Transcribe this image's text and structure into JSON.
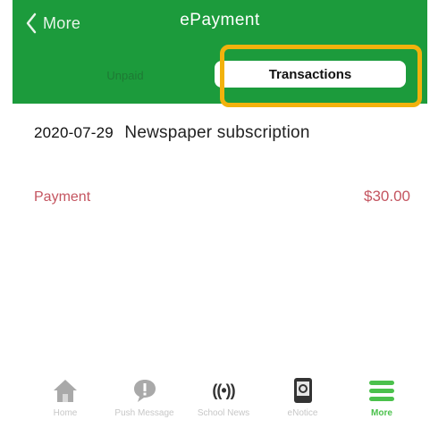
{
  "header": {
    "back_label": "More",
    "title": "ePayment"
  },
  "tabs": {
    "unpaid": "Unpaid",
    "transactions": "Transactions"
  },
  "transaction": {
    "date": "2020-07-29",
    "description": "Newspaper subscription",
    "type": "Payment",
    "amount": "$30.00"
  },
  "tabbar": {
    "items": [
      {
        "label": "Home",
        "icon": "home-icon"
      },
      {
        "label": "Push Message",
        "icon": "message-alert-icon"
      },
      {
        "label": "School News",
        "icon": "broadcast-icon"
      },
      {
        "label": "eNotice",
        "icon": "notice-book-icon"
      },
      {
        "label": "More",
        "icon": "hamburger-menu-icon",
        "active": true
      }
    ]
  },
  "colors": {
    "header_bg": "#1c9b3c",
    "highlight": "#f2b20c",
    "payment_text": "#c45560",
    "active_tab": "#4bc14c"
  }
}
